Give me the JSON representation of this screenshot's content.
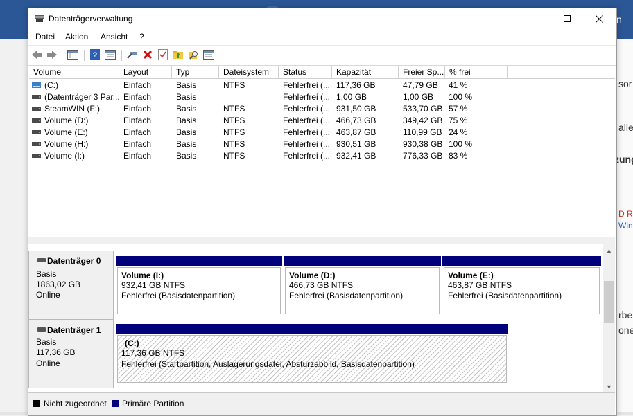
{
  "window": {
    "title": "Datenträgerverwaltung"
  },
  "menu": [
    "Datei",
    "Aktion",
    "Ansicht",
    "?"
  ],
  "background_fragments": [
    "n",
    "sor",
    "alle",
    "zung",
    "D Rac",
    "Windo",
    "rbei",
    "oner"
  ],
  "columns": [
    "Volume",
    "Layout",
    "Typ",
    "Dateisystem",
    "Status",
    "Kapazität",
    "Freier Sp...",
    "% frei"
  ],
  "volumes": [
    {
      "name": "(C:)",
      "layout": "Einfach",
      "typ": "Basis",
      "fs": "NTFS",
      "status": "Fehlerfrei (...",
      "capacity": "117,36 GB",
      "free": "47,79 GB",
      "pct": "41 %"
    },
    {
      "name": "(Datenträger 3 Par...",
      "layout": "Einfach",
      "typ": "Basis",
      "fs": "",
      "status": "Fehlerfrei (...",
      "capacity": "1,00 GB",
      "free": "1,00 GB",
      "pct": "100 %"
    },
    {
      "name": "SteamWIN (F:)",
      "layout": "Einfach",
      "typ": "Basis",
      "fs": "NTFS",
      "status": "Fehlerfrei (...",
      "capacity": "931,50 GB",
      "free": "533,70 GB",
      "pct": "57 %"
    },
    {
      "name": "Volume (D:)",
      "layout": "Einfach",
      "typ": "Basis",
      "fs": "NTFS",
      "status": "Fehlerfrei (...",
      "capacity": "466,73 GB",
      "free": "349,42 GB",
      "pct": "75 %"
    },
    {
      "name": "Volume (E:)",
      "layout": "Einfach",
      "typ": "Basis",
      "fs": "NTFS",
      "status": "Fehlerfrei (...",
      "capacity": "463,87 GB",
      "free": "110,99 GB",
      "pct": "24 %"
    },
    {
      "name": "Volume (H:)",
      "layout": "Einfach",
      "typ": "Basis",
      "fs": "NTFS",
      "status": "Fehlerfrei (...",
      "capacity": "930,51 GB",
      "free": "930,38 GB",
      "pct": "100 %"
    },
    {
      "name": "Volume (I:)",
      "layout": "Einfach",
      "typ": "Basis",
      "fs": "NTFS",
      "status": "Fehlerfrei (...",
      "capacity": "932,41 GB",
      "free": "776,33 GB",
      "pct": "83 %"
    }
  ],
  "disks": [
    {
      "name": "Datenträger 0",
      "type": "Basis",
      "size": "1863,02 GB",
      "state": "Online",
      "partitions": [
        {
          "title": "Volume  (I:)",
          "size": "932,41 GB NTFS",
          "status": "Fehlerfrei (Basisdatenpartition)"
        },
        {
          "title": "Volume  (D:)",
          "size": "466,73 GB NTFS",
          "status": "Fehlerfrei (Basisdatenpartition)"
        },
        {
          "title": "Volume  (E:)",
          "size": "463,87 GB NTFS",
          "status": "Fehlerfrei (Basisdatenpartition)"
        }
      ]
    },
    {
      "name": "Datenträger 1",
      "type": "Basis",
      "size": "117,36 GB",
      "state": "Online",
      "partitions": [
        {
          "title": "(C:)",
          "size": "117,36 GB NTFS",
          "status": "Fehlerfrei (Startpartition, Auslagerungsdatei, Absturzabbild, Basisdatenpartition)"
        }
      ]
    }
  ],
  "legend": [
    {
      "label": "Nicht zugeordnet",
      "color": "#000000"
    },
    {
      "label": "Primäre Partition",
      "color": "#01017c"
    }
  ],
  "toolbar_icons": [
    "back-icon",
    "forward-icon",
    "console-tree-icon",
    "help-icon",
    "properties-icon",
    "connect-icon",
    "delete-icon",
    "check-icon",
    "folder-up-icon",
    "search-folder-icon",
    "list-view-icon"
  ]
}
